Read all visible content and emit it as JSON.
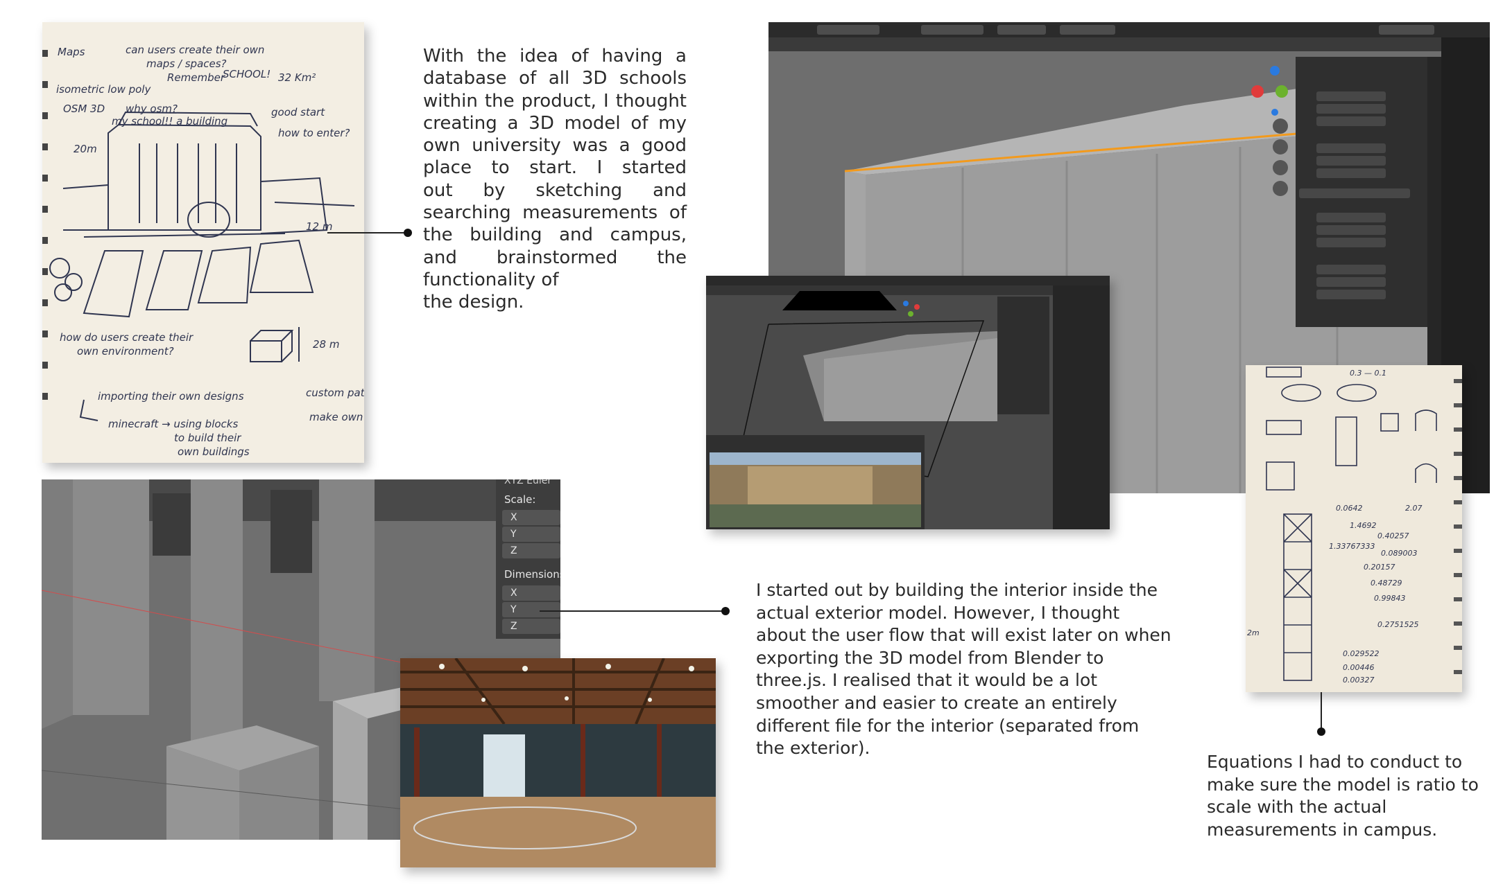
{
  "text_blocks": {
    "sketch_caption_lines": [
      "With the idea of having a",
      "database of all 3D schools",
      "within the product, I thought",
      "creating a 3D model of my",
      "own university was a good",
      "place to start. I started",
      "out by sketching and",
      "searching measurements of",
      "the building and campus,",
      "and brainstormed the",
      "functionality of"
    ],
    "sketch_caption_last": "the design.",
    "interior_caption": "I started out by building the interior inside the actual exterior model. However, I thought about the user flow that will exist later on when exporting the 3D model from Blender to three.js. I realised that it would be a lot smoother and easier to create an entirely different file for the interior (separated from the exterior).",
    "equations_caption": "Equations I had to conduct to make sure the model is ratio to scale with the actual measurements in campus."
  },
  "blender_panel": {
    "scale_label": "Scale:",
    "axes": [
      "X",
      "Y",
      "Z"
    ],
    "dimensions_label": "Dimensions",
    "header_fragment": "XYZ Euler"
  },
  "colors": {
    "blender_bg": "#3d3d3d",
    "viewport_grey": "#6f6f6f",
    "model_grey": "#9a9a9a",
    "selection_orange": "#f39a1c",
    "paper": "#f4efe4",
    "ink": "#2f3550"
  }
}
